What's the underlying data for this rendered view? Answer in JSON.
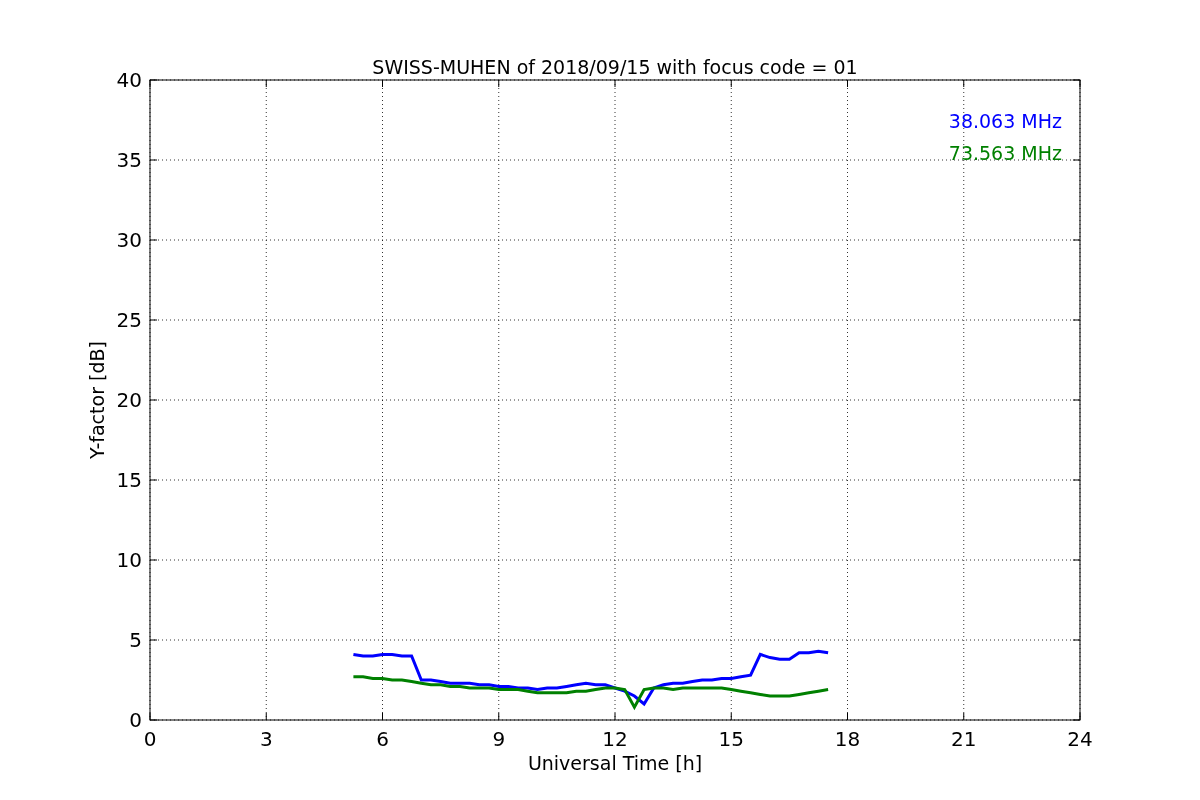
{
  "figure": {
    "chart_data": {
      "type": "line",
      "title": "SWISS-MUHEN of 2018/09/15 with focus code = 01",
      "xlabel": "Universal Time [h]",
      "ylabel": "Y-factor [dB]",
      "xlim": [
        0,
        24
      ],
      "ylim": [
        0,
        40
      ],
      "xticks": [
        0,
        3,
        6,
        9,
        12,
        15,
        18,
        21,
        24
      ],
      "yticks": [
        0,
        5,
        10,
        15,
        20,
        25,
        30,
        35,
        40
      ],
      "grid": true,
      "x": [
        5.25,
        5.5,
        5.75,
        6,
        6.25,
        6.5,
        6.75,
        7,
        7.25,
        7.5,
        7.75,
        8,
        8.25,
        8.5,
        8.75,
        9,
        9.25,
        9.5,
        9.75,
        10,
        10.25,
        10.5,
        10.75,
        11,
        11.25,
        11.5,
        11.75,
        12,
        12.25,
        12.5,
        12.75,
        13,
        13.25,
        13.5,
        13.75,
        14,
        14.25,
        14.5,
        14.75,
        15,
        15.25,
        15.5,
        15.75,
        16,
        16.25,
        16.5,
        16.75,
        17,
        17.25,
        17.5
      ],
      "series": [
        {
          "name": "38.063 MHz",
          "color": "#0000ff",
          "values": [
            4.1,
            4.0,
            4.0,
            4.1,
            4.1,
            4.0,
            4.0,
            2.5,
            2.5,
            2.4,
            2.3,
            2.3,
            2.3,
            2.2,
            2.2,
            2.1,
            2.1,
            2.0,
            2.0,
            1.9,
            2.0,
            2.0,
            2.1,
            2.2,
            2.3,
            2.2,
            2.2,
            2.0,
            1.8,
            1.5,
            1.0,
            2.0,
            2.2,
            2.3,
            2.3,
            2.4,
            2.5,
            2.5,
            2.6,
            2.6,
            2.7,
            2.8,
            4.1,
            3.9,
            3.8,
            3.8,
            4.2,
            4.2,
            4.3,
            4.2
          ]
        },
        {
          "name": "73.563 MHz",
          "color": "#008000",
          "values": [
            2.7,
            2.7,
            2.6,
            2.6,
            2.5,
            2.5,
            2.4,
            2.3,
            2.2,
            2.2,
            2.1,
            2.1,
            2.0,
            2.0,
            2.0,
            1.9,
            1.9,
            1.9,
            1.8,
            1.7,
            1.7,
            1.7,
            1.7,
            1.8,
            1.8,
            1.9,
            2.0,
            2.0,
            1.9,
            0.8,
            1.9,
            2.0,
            2.0,
            1.9,
            2.0,
            2.0,
            2.0,
            2.0,
            2.0,
            1.9,
            1.8,
            1.7,
            1.6,
            1.5,
            1.5,
            1.5,
            1.6,
            1.7,
            1.8,
            1.9
          ]
        }
      ]
    }
  }
}
